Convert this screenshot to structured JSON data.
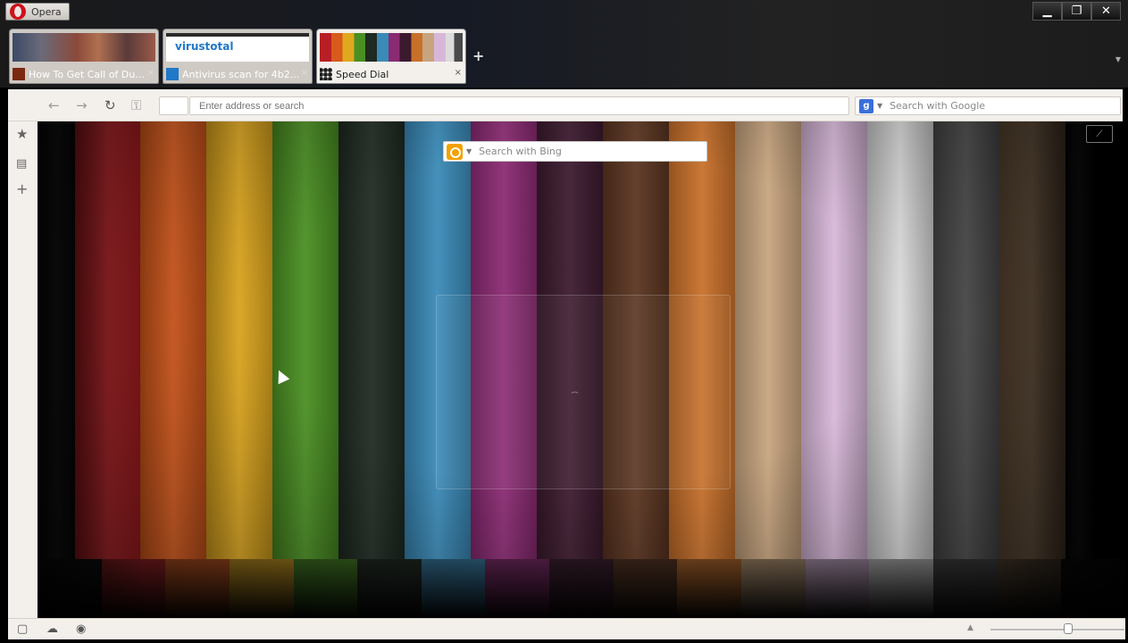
{
  "window": {
    "app_label": "Opera",
    "controls": {
      "minimize": "▁",
      "restore": "❐",
      "close": "✕"
    }
  },
  "tabs": [
    {
      "title": "How To Get Call of Du...",
      "favicon_color": "#7a2a10",
      "active": false,
      "close": "×"
    },
    {
      "title": "Antivirus scan for 4b2...",
      "favicon_color": "#1f78c8",
      "active": false,
      "close": "×",
      "thumb_brand": "virustotal"
    },
    {
      "title": "Speed Dial",
      "favicon_color": "#555555",
      "active": true,
      "close": "×"
    }
  ],
  "new_tab_label": "+",
  "toolbar": {
    "address_placeholder": "Enter address or search",
    "search_placeholder": "Search with Google",
    "search_engine_letter": "g"
  },
  "speed_dial": {
    "search_placeholder": "Search with Bing",
    "stripe_colors": [
      "#0a0a0a",
      "#b81f24",
      "#d85a1c",
      "#e0a81e",
      "#4a8f22",
      "#1f2a22",
      "#3a8ab8",
      "#8a2a72",
      "#3c1a2e",
      "#5a3420",
      "#c8702a",
      "#c7a47e",
      "#d7b7d8",
      "#dcdcdc",
      "#4a4a4a",
      "#5a4632",
      "#050505"
    ]
  },
  "colors": {
    "chrome_bg": "#f3f0ec",
    "opera_red": "#d0101a"
  }
}
